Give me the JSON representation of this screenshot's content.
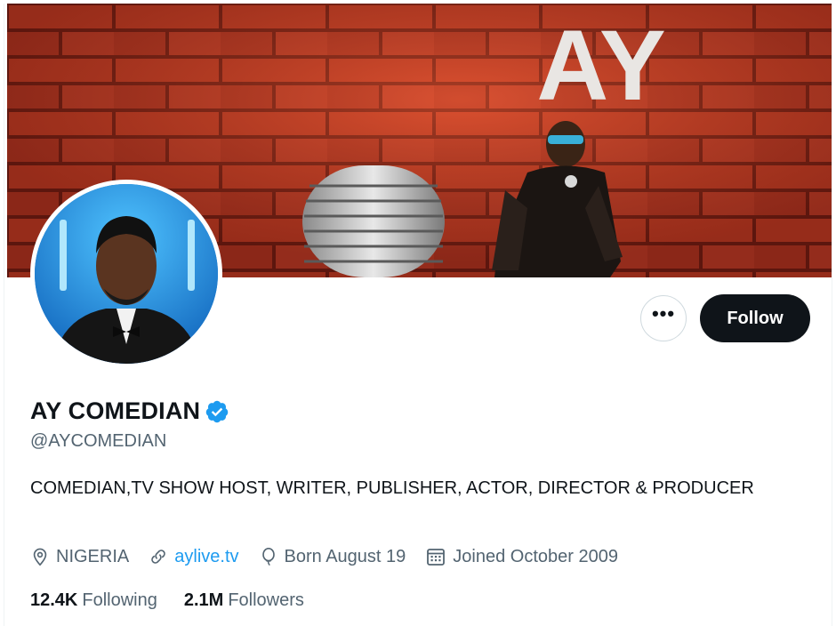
{
  "banner": {
    "logo_text": "AY"
  },
  "profile": {
    "display_name": "AY COMEDIAN",
    "handle": "@AYCOMEDIAN",
    "bio": "COMEDIAN,TV SHOW HOST, WRITER, PUBLISHER, ACTOR, DIRECTOR & PRODUCER",
    "verified": true
  },
  "actions": {
    "more_label": "•••",
    "follow_label": "Follow"
  },
  "meta": {
    "location": "NIGERIA",
    "website": "aylive.tv",
    "birthday": "Born August 19",
    "joined": "Joined October 2009"
  },
  "stats": {
    "following_count": "12.4K",
    "following_label": "Following",
    "followers_count": "2.1M",
    "followers_label": "Followers"
  },
  "colors": {
    "accent": "#1d9bf0",
    "text_primary": "#0f1419",
    "text_secondary": "#536471",
    "button_dark": "#0f1419",
    "banner_brick": "#b8321e"
  }
}
